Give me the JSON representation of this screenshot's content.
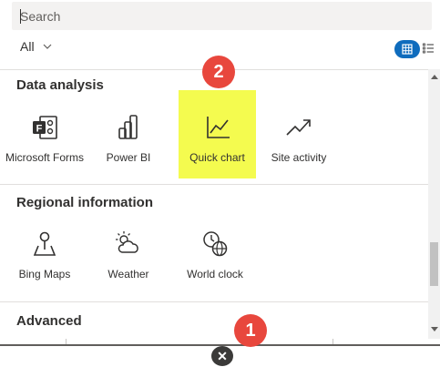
{
  "search": {
    "placeholder": "Search",
    "value": ""
  },
  "filter": {
    "selected": "All"
  },
  "view_toggle": {
    "grid_icon": "grid-icon",
    "list_icon": "list-icon",
    "active": "grid"
  },
  "sections": [
    {
      "title": "Data analysis",
      "items": [
        {
          "label": "Microsoft Forms",
          "icon": "forms-icon"
        },
        {
          "label": "Power BI",
          "icon": "power-bi-icon"
        },
        {
          "label": "Quick chart",
          "icon": "quick-chart-icon"
        },
        {
          "label": "Site activity",
          "icon": "site-activity-icon"
        }
      ]
    },
    {
      "title": "Regional information",
      "items": [
        {
          "label": "Bing Maps",
          "icon": "map-pin-icon"
        },
        {
          "label": "Weather",
          "icon": "weather-icon"
        },
        {
          "label": "World clock",
          "icon": "world-clock-icon"
        }
      ]
    },
    {
      "title": "Advanced",
      "items": []
    }
  ],
  "annotations": {
    "marker1": "1",
    "marker2": "2"
  },
  "close_glyph": "✕",
  "colors": {
    "highlight": "#f4fb4f",
    "accent": "#0f6cbd",
    "marker": "#e8473d"
  }
}
